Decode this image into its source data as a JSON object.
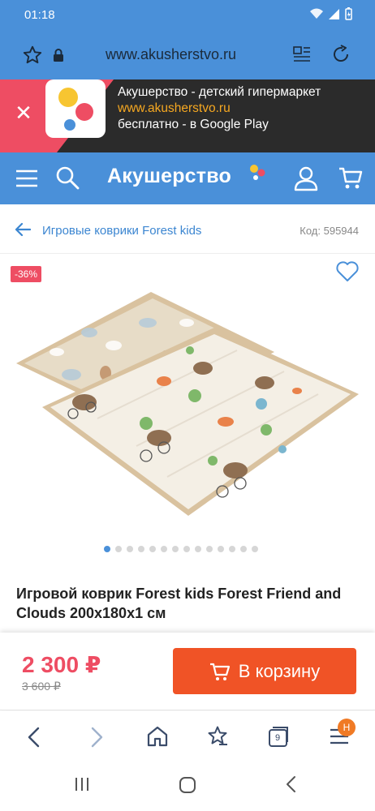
{
  "status": {
    "time": "01:18"
  },
  "browser": {
    "url": "www.akusherstvo.ru",
    "tab_count": "9",
    "menu_badge": "Н"
  },
  "app_banner": {
    "line1": "Акушерство - детский гипермаркет",
    "line2": "www.akusherstvo.ru",
    "line3": "бесплатно - в Google Play"
  },
  "header": {
    "logo": "Акушерство"
  },
  "breadcrumb": {
    "label": "Игровые коврики Forest kids",
    "code": "Код: 595944"
  },
  "product": {
    "discount": "-36%",
    "title": "Игровой коврик Forest kids Forest Friend and Clouds 200x180x1 см",
    "price": "2 300 ₽",
    "old_price": "3 600 ₽",
    "cart_label": "В корзину",
    "gallery_dots_total": 14,
    "gallery_active_index": 0
  },
  "colors": {
    "accent": "#4a90d9",
    "cta": "#f05326",
    "sale": "#ee4d63",
    "banner_dark": "#2b2b2b"
  }
}
